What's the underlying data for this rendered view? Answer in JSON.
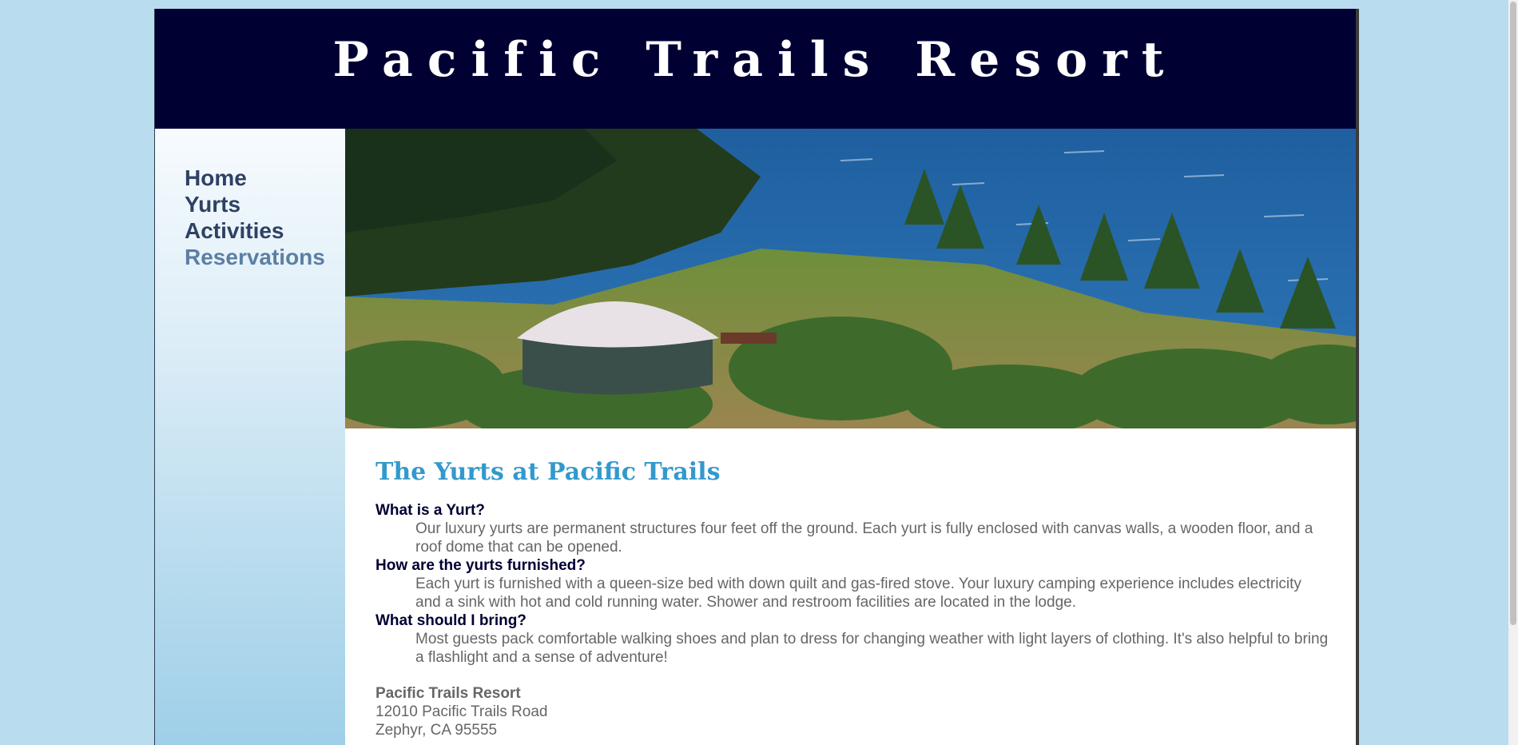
{
  "site": {
    "title": "Pacific Trails Resort"
  },
  "nav": {
    "items": [
      {
        "label": "Home"
      },
      {
        "label": "Yurts"
      },
      {
        "label": "Activities"
      },
      {
        "label": "Reservations"
      }
    ],
    "current": "Reservations"
  },
  "hero": {
    "alt": "yurt among pine trees above the ocean"
  },
  "main": {
    "heading": "The Yurts at Pacific Trails",
    "faq": [
      {
        "question": "What is a Yurt?",
        "answer": "Our luxury yurts are permanent structures four feet off the ground. Each yurt is fully enclosed with canvas walls, a wooden floor, and a roof dome that can be opened."
      },
      {
        "question": "How are the yurts furnished?",
        "answer": "Each yurt is furnished with a queen-size bed with down quilt and gas-fired stove. Your luxury camping experience includes electricity and a sink with hot and cold running water. Shower and restroom facilities are located in the lodge."
      },
      {
        "question": "What should I bring?",
        "answer": "Most guests pack comfortable walking shoes and plan to dress for changing weather with light layers of clothing. It's also helpful to bring a flashlight and a sense of adventure!"
      }
    ],
    "contact": {
      "name": "Pacific Trails Resort",
      "street": "12010 Pacific Trails Road",
      "city": "Zephyr, CA 95555"
    }
  },
  "colors": {
    "page_background": "#b9dcee",
    "header_background": "#000033",
    "heading": "#3399cc",
    "nav_text": "#2f4163",
    "nav_current": "#5c7fa3",
    "body_text": "#666666"
  }
}
